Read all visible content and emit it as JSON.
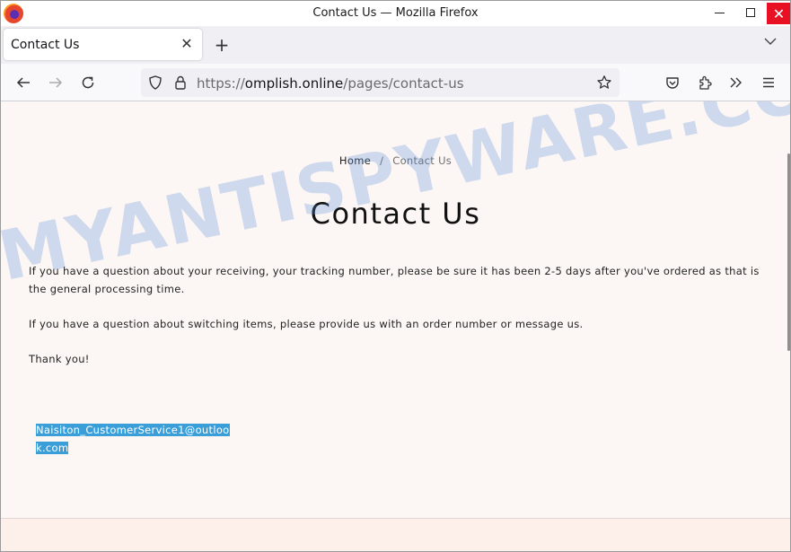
{
  "window": {
    "title": "Contact Us — Mozilla Firefox",
    "controls": {
      "minimize": "minimize",
      "maximize": "maximize",
      "close": "✕"
    }
  },
  "tabs": [
    {
      "label": "Contact Us",
      "active": true,
      "close": "✕"
    }
  ],
  "tabbar": {
    "new_tab": "+"
  },
  "navbar": {
    "url_scheme": "https://",
    "url_host": "omplish.online",
    "url_path": "/pages/contact-us"
  },
  "page": {
    "breadcrumb": {
      "home": "Home",
      "separator": "/",
      "current": "Contact Us"
    },
    "title": "Contact Us",
    "paragraphs": [
      "If you have a question about your receiving, your tracking number, please be sure it has been 2-5 days after you've ordered as that is the general processing time.",
      "If you have a question about switching items, please provide us with an order number or message us.",
      "Thank you!"
    ],
    "email": "Naisiton_CustomerService1@outlook.com"
  },
  "watermark": "MYANTISPYWARE.COM",
  "colors": {
    "close_button": "#e81123",
    "selection": "#3a9fd8",
    "page_background": "#fcf7f4"
  }
}
